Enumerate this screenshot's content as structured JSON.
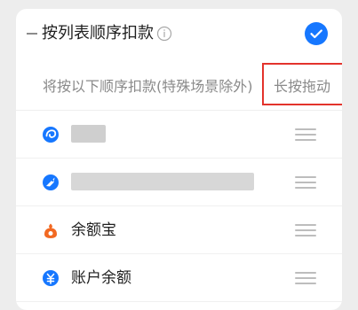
{
  "payment_order": {
    "title": "按列表顺序扣款",
    "enabled": true,
    "hint": {
      "text": "将按以下顺序扣款(特殊场景除外)",
      "action_label": "长按拖动"
    },
    "items": [
      {
        "label": "",
        "icon": "blue-spiral-icon",
        "masked": true
      },
      {
        "label": "",
        "icon": "blue-rocket-icon",
        "masked": true
      },
      {
        "label": "余额宝",
        "icon": "orange-yuebao-icon",
        "masked": false
      },
      {
        "label": "账户余额",
        "icon": "blue-yuan-icon",
        "masked": false
      }
    ]
  },
  "colors": {
    "primary_blue": "#1677ff",
    "highlight_red": "#e3332c",
    "yuebao_orange": "#f26922"
  }
}
